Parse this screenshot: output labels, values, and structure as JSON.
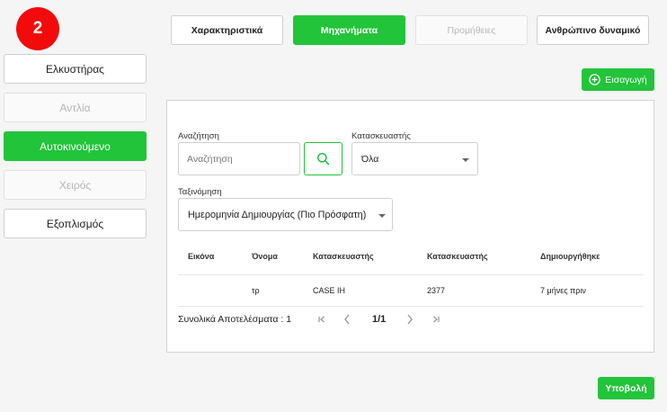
{
  "step_badge": "2",
  "sidebar": {
    "items": [
      {
        "label": "Ελκυστήρας",
        "state": "normal"
      },
      {
        "label": "Αντλία",
        "state": "disabled"
      },
      {
        "label": "Αυτοκινούμενο",
        "state": "active"
      },
      {
        "label": "Χειρός",
        "state": "disabled"
      },
      {
        "label": "Εξοπλισμός",
        "state": "normal"
      }
    ]
  },
  "tabs": [
    {
      "label": "Χαρακτηριστικά",
      "state": "normal"
    },
    {
      "label": "Μηχανήματα",
      "state": "active"
    },
    {
      "label": "Προμήθειες",
      "state": "disabled"
    },
    {
      "label": "Ανθρώπινο δυναμικό",
      "state": "normal"
    }
  ],
  "insert_button": {
    "label": "Εισαγωγή",
    "icon": "plus-circle-icon"
  },
  "search": {
    "label": "Αναζήτηση",
    "placeholder": "Αναζήτηση",
    "button_icon": "search-icon"
  },
  "manufacturer_filter": {
    "label": "Κατασκευαστής",
    "value": "Όλα"
  },
  "sort": {
    "label": "Ταξινόμηση",
    "value": "Ημερομηνία Δημιουργίας (Πιο Πρόσφατη)"
  },
  "table": {
    "headers": [
      "Εικόνα",
      "Όνομα",
      "Κατασκευαστής",
      "Κατασκευαστής",
      "Δημιουργήθηκε"
    ],
    "rows": [
      [
        "",
        "τρ",
        "CASE IH",
        "2377",
        "7 μήνες πριν"
      ]
    ]
  },
  "pagination": {
    "total_label": "Συνολικά Αποτελέσματα : 1",
    "page": "1/1"
  },
  "submit_button": {
    "label": "Υποβολή"
  },
  "colors": {
    "accent": "#22c43a",
    "badge": "#f30a0a"
  }
}
